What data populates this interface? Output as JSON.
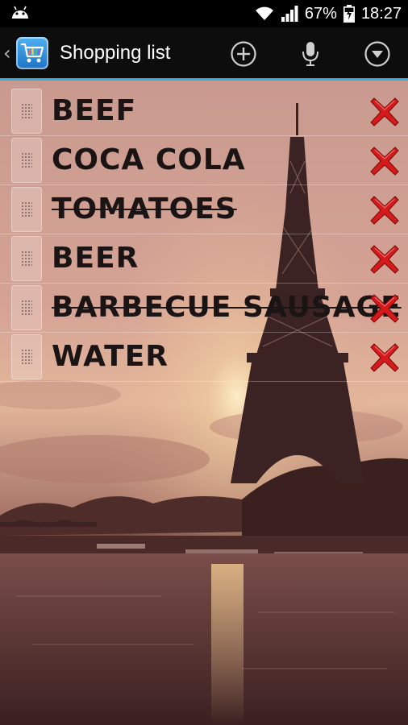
{
  "status_bar": {
    "battery_percent": "67%",
    "time": "18:27",
    "icons": [
      "android-icon",
      "wifi-icon",
      "signal-icon",
      "battery-charging-icon"
    ]
  },
  "action_bar": {
    "title": "Shopping list",
    "actions": [
      "add-circle-icon",
      "microphone-icon",
      "dropdown-circle-icon"
    ],
    "accent_color": "#39a9d8"
  },
  "items": [
    {
      "label": "BEEF",
      "checked": false
    },
    {
      "label": "COCA COLA",
      "checked": false
    },
    {
      "label": "TOMATOES",
      "checked": true
    },
    {
      "label": "BEER",
      "checked": false
    },
    {
      "label": "BARBECUE SAUSAGE",
      "checked": true
    },
    {
      "label": "WATER",
      "checked": false
    }
  ],
  "delete_color": "#d41a1a"
}
